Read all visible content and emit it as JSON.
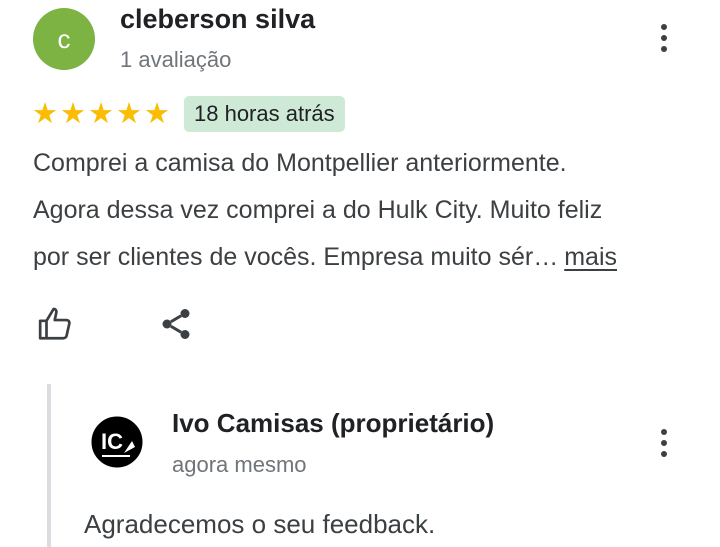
{
  "review": {
    "avatar_letter": "c",
    "reviewer_name": "cleberson silva",
    "reviewer_meta": "1 avaliação",
    "rating": 5,
    "max_rating": 5,
    "time_badge": "18 horas atrás",
    "text_lines": [
      "Comprei a camisa do Montpellier anteriormente.",
      "Agora dessa vez comprei a do Hulk City. Muito feliz",
      "por ser clientes de vocês. Empresa muito sér…"
    ],
    "more_label": "mais"
  },
  "reply": {
    "owner_name": "Ivo Camisas (proprietário)",
    "time": "agora mesmo",
    "text": "Agradecemos o seu feedback.",
    "logo_text": "IC"
  },
  "icons": {
    "more_options": "more-vert-icon",
    "like": "thumb-up-icon",
    "share": "share-icon",
    "star": "star-icon"
  },
  "colors": {
    "avatar_bg": "#7cb342",
    "star": "#fbbc04",
    "time_badge_bg": "#ceead6",
    "owner_logo_bg": "#000000"
  }
}
